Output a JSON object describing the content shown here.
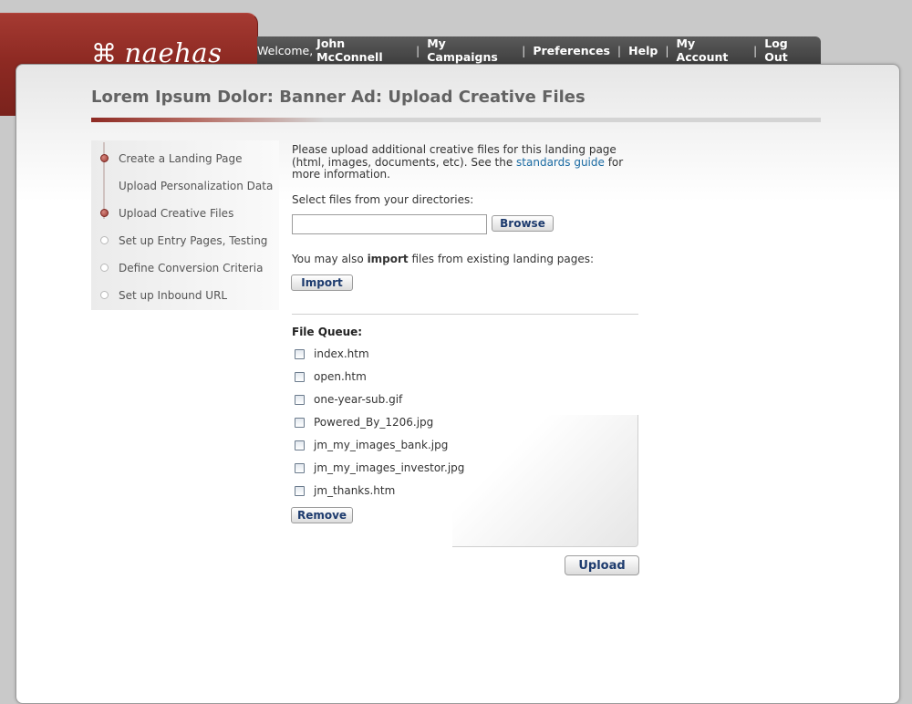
{
  "brand": {
    "logo_glyph": "๑",
    "logo_text": "naehas",
    "accent_color": "#8e2a23"
  },
  "nav": {
    "welcome_prefix": "Welcome,",
    "user_name": "John McConnell",
    "links": [
      "My Campaigns",
      "Preferences",
      "Help",
      "My Account",
      "Log Out"
    ],
    "separator": "|"
  },
  "page": {
    "title": "Lorem Ipsum Dolor: Banner Ad: Upload Creative Files"
  },
  "steps": [
    {
      "label": "Create a Landing Page",
      "status": "complete"
    },
    {
      "label": "Upload Personalization Data",
      "status": "none"
    },
    {
      "label": "Upload Creative Files",
      "status": "current"
    },
    {
      "label": "Set up Entry Pages, Testing",
      "status": "pending"
    },
    {
      "label": "Define Conversion Criteria",
      "status": "pending"
    },
    {
      "label": "Set up Inbound URL",
      "status": "pending"
    }
  ],
  "content": {
    "intro_before_link": "Please upload additional creative files for this landing page (html, images, documents, etc). See the ",
    "intro_link": "standards guide",
    "intro_after_link": " for more information.",
    "select_label": "Select files from your directories:",
    "file_input_value": "",
    "browse_label": "Browse",
    "import_prefix": "You may also ",
    "import_bold": "import",
    "import_suffix": " files from existing landing pages:",
    "import_label": "Import",
    "queue_title": "File Queue:",
    "queue": [
      {
        "name": "index.htm",
        "checked": false
      },
      {
        "name": "open.htm",
        "checked": false
      },
      {
        "name": "one-year-sub.gif",
        "checked": false
      },
      {
        "name": "Powered_By_1206.jpg",
        "checked": false
      },
      {
        "name": "jm_my_images_bank.jpg",
        "checked": false
      },
      {
        "name": "jm_my_images_investor.jpg",
        "checked": false
      },
      {
        "name": "jm_thanks.htm",
        "checked": false
      }
    ],
    "remove_label": "Remove",
    "upload_label": "Upload"
  }
}
